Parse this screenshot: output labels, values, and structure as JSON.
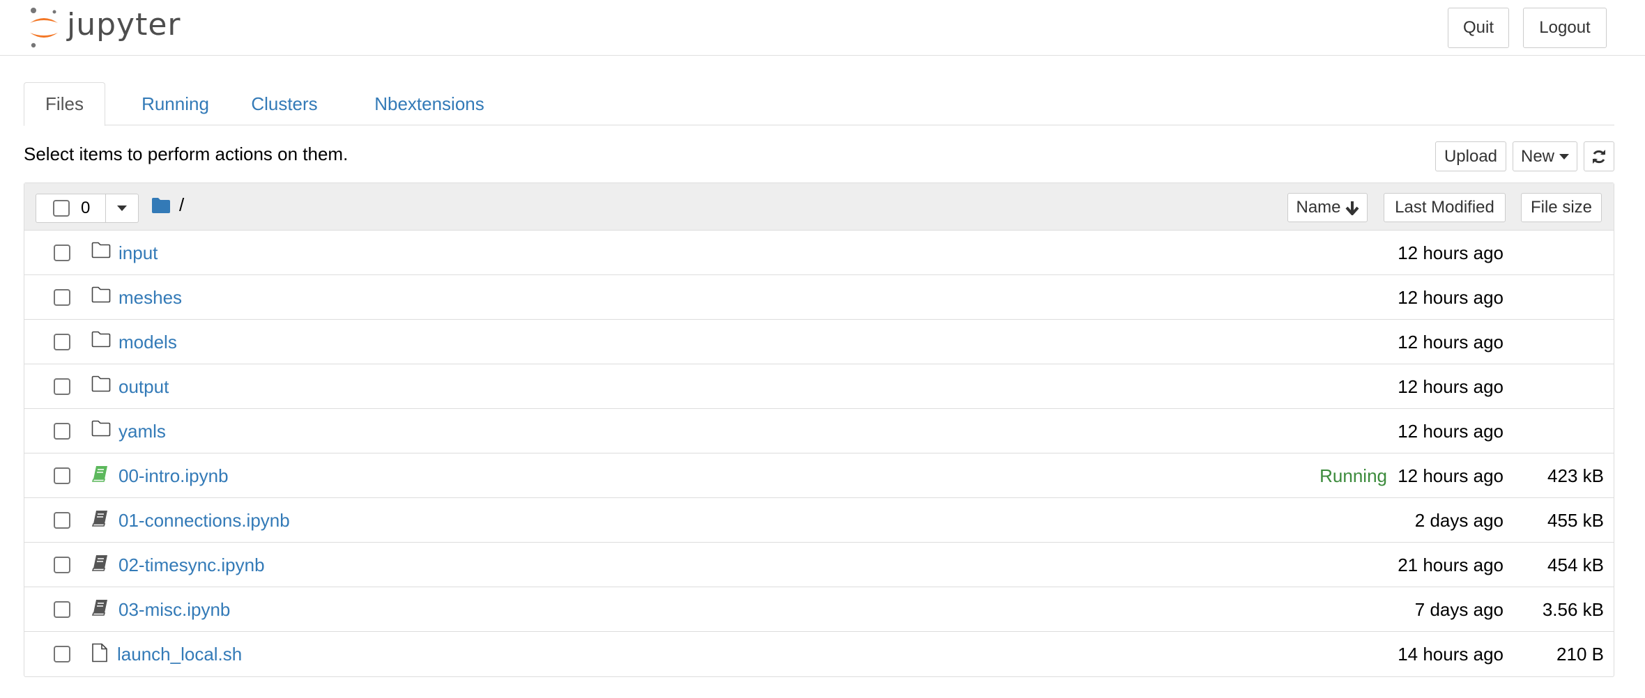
{
  "header": {
    "logo_text": "jupyter",
    "quit_label": "Quit",
    "logout_label": "Logout"
  },
  "tabs": [
    {
      "label": "Files",
      "active": true
    },
    {
      "label": "Running",
      "active": false
    },
    {
      "label": "Clusters",
      "active": false
    },
    {
      "label": "Nbextensions",
      "active": false
    }
  ],
  "toolbar": {
    "hint": "Select items to perform actions on them.",
    "upload_label": "Upload",
    "new_label": "New",
    "refresh_icon": "refresh-icon"
  },
  "list_header": {
    "selected_count": "0",
    "breadcrumb": "/",
    "sort_name_label": "Name",
    "sort_modified_label": "Last Modified",
    "sort_size_label": "File size"
  },
  "colors": {
    "link": "#337ab7",
    "running": "#3c8b3c",
    "notebook_running_icon": "#5cb85c",
    "notebook_icon": "#555555",
    "folder_breadcrumb": "#337ab7",
    "logo_orange": "#f37726"
  },
  "items": [
    {
      "type": "folder",
      "icon": "folder-icon",
      "name": "input",
      "running": "",
      "modified": "12 hours ago",
      "size": ""
    },
    {
      "type": "folder",
      "icon": "folder-icon",
      "name": "meshes",
      "running": "",
      "modified": "12 hours ago",
      "size": ""
    },
    {
      "type": "folder",
      "icon": "folder-icon",
      "name": "models",
      "running": "",
      "modified": "12 hours ago",
      "size": ""
    },
    {
      "type": "folder",
      "icon": "folder-icon",
      "name": "output",
      "running": "",
      "modified": "12 hours ago",
      "size": ""
    },
    {
      "type": "folder",
      "icon": "folder-icon",
      "name": "yamls",
      "running": "",
      "modified": "12 hours ago",
      "size": ""
    },
    {
      "type": "notebook-running",
      "icon": "notebook-icon",
      "name": "00-intro.ipynb",
      "running": "Running",
      "modified": "12 hours ago",
      "size": "423 kB"
    },
    {
      "type": "notebook",
      "icon": "notebook-icon",
      "name": "01-connections.ipynb",
      "running": "",
      "modified": "2 days ago",
      "size": "455 kB"
    },
    {
      "type": "notebook",
      "icon": "notebook-icon",
      "name": "02-timesync.ipynb",
      "running": "",
      "modified": "21 hours ago",
      "size": "454 kB"
    },
    {
      "type": "notebook",
      "icon": "notebook-icon",
      "name": "03-misc.ipynb",
      "running": "",
      "modified": "7 days ago",
      "size": "3.56 kB"
    },
    {
      "type": "file",
      "icon": "file-icon",
      "name": "launch_local.sh",
      "running": "",
      "modified": "14 hours ago",
      "size": "210 B"
    }
  ]
}
